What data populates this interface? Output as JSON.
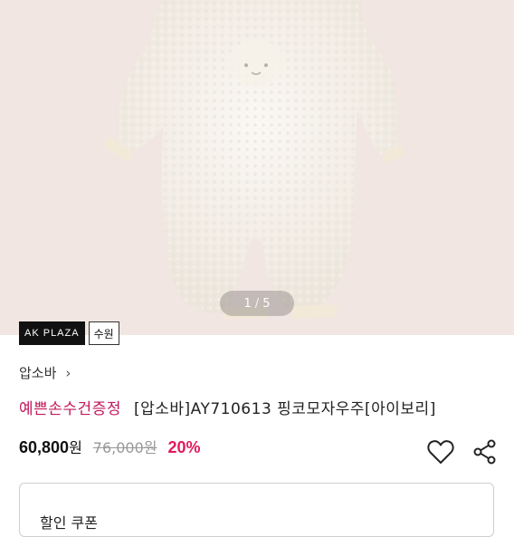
{
  "gallery": {
    "current": "1",
    "separator": "/",
    "total": "5"
  },
  "badges": {
    "store": "AK PLAZA",
    "branch": "수원"
  },
  "brand": {
    "name": "압소바",
    "chevron": "›"
  },
  "product": {
    "promo": "예쁜손수건증정",
    "name": "[압소바]AY710613 핑코모자우주[아이보리]"
  },
  "pricing": {
    "sale_price": "60,800",
    "currency": "원",
    "original_price": "76,000원",
    "discount": "20%"
  },
  "actions": {
    "wishlist_icon": "heart-icon",
    "share_icon": "share-icon"
  },
  "panel": {
    "text": "할인 쿠폰"
  },
  "colors": {
    "promo": "#c2185b",
    "discount": "#e21a5e",
    "hero_bg": "#f1e6e2"
  }
}
